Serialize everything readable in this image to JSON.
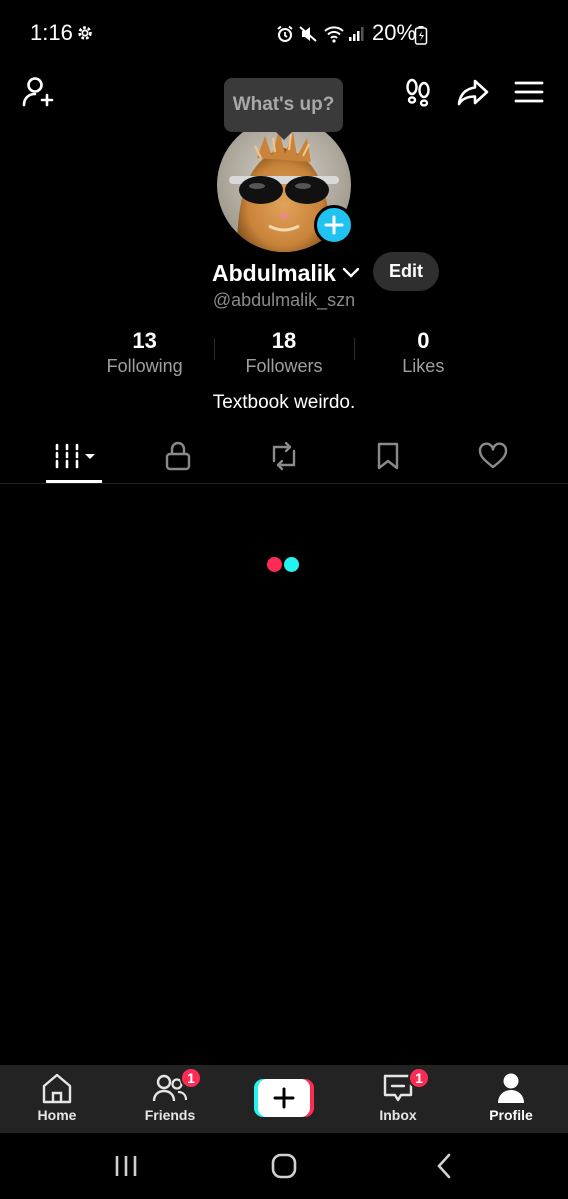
{
  "status_bar": {
    "time": "1:16",
    "battery": "20%",
    "icons": [
      "settings-icon",
      "alarm-icon",
      "mute-icon",
      "wifi-icon",
      "signal-icon",
      "battery-charging-icon"
    ]
  },
  "topbar": {
    "left_icon": "add-friend-icon",
    "right_icons": [
      "footprints-icon",
      "share-icon",
      "menu-icon"
    ]
  },
  "tooltip": {
    "text": "What's up?"
  },
  "profile": {
    "display_name": "Abdulmalik",
    "username": "@abdulmalik_szn",
    "edit_label": "Edit",
    "bio": "Textbook weirdo.",
    "stats": [
      {
        "value": "13",
        "label": "Following"
      },
      {
        "value": "18",
        "label": "Followers"
      },
      {
        "value": "0",
        "label": "Likes"
      }
    ]
  },
  "tabs": [
    "videos-grid-icon",
    "lock-icon",
    "repost-icon",
    "bookmark-icon",
    "heart-icon"
  ],
  "loader_colors": {
    "left": "#fe2c55",
    "right": "#25f4ee"
  },
  "bottom_nav": {
    "home": "Home",
    "friends": "Friends",
    "friends_badge": "1",
    "inbox": "Inbox",
    "inbox_badge": "1",
    "profile": "Profile"
  },
  "colors": {
    "accent_blue": "#20c3f0",
    "badge_red": "#fe2c55",
    "create_cyan": "#25f4ee"
  }
}
